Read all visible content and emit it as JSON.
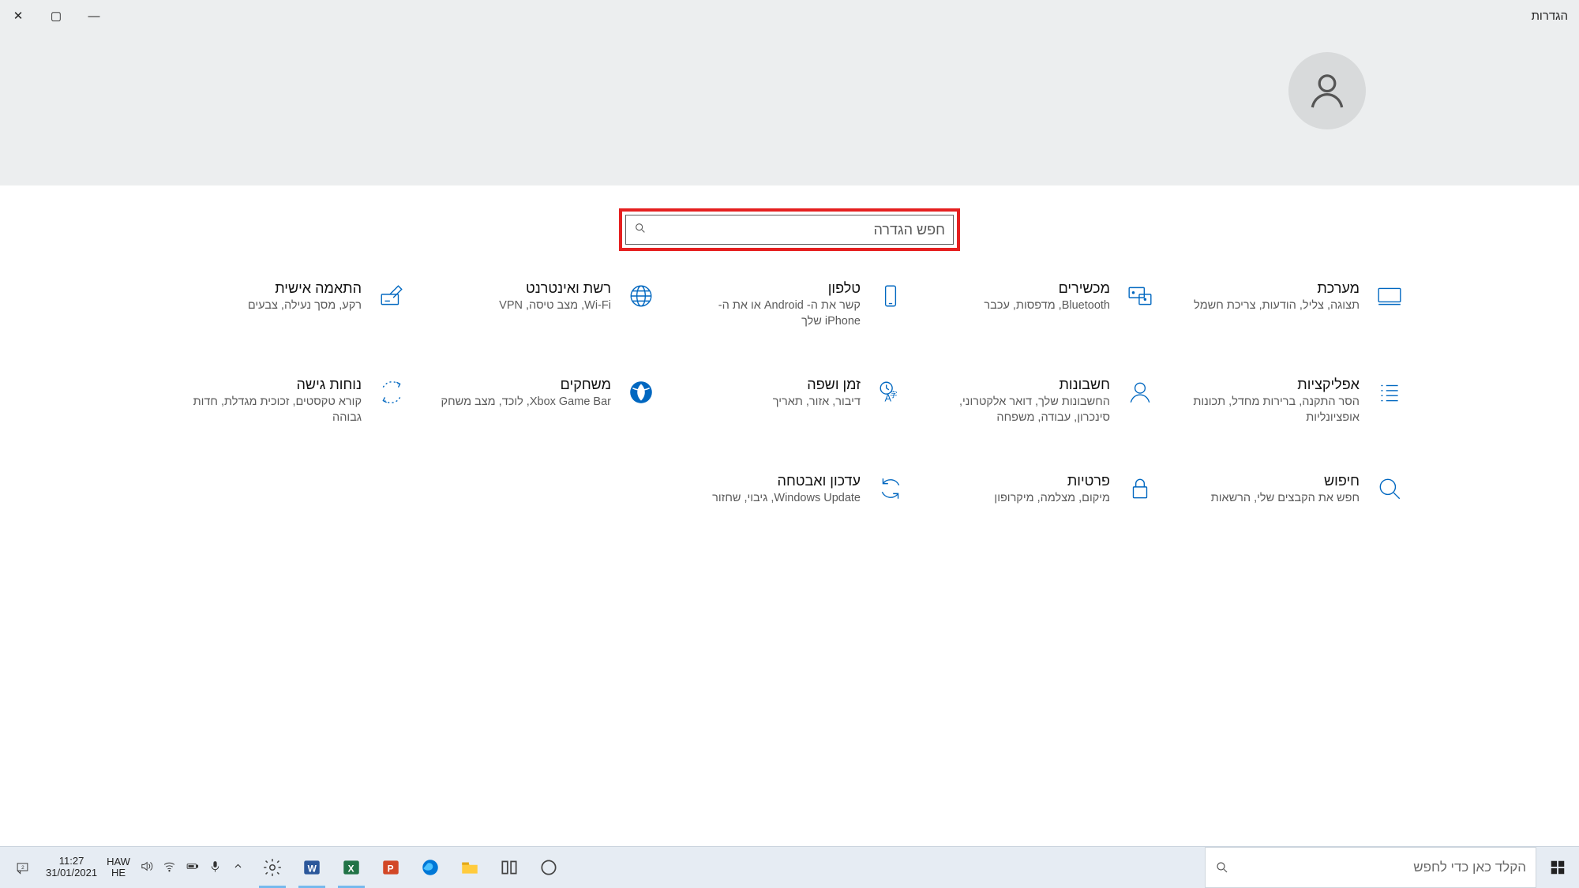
{
  "window": {
    "title": "הגדרות"
  },
  "search": {
    "placeholder": "חפש הגדרה"
  },
  "categories": [
    {
      "id": "system",
      "title": "מערכת",
      "desc": "תצוגה, צליל, הודעות, צריכת חשמל"
    },
    {
      "id": "devices",
      "title": "מכשירים",
      "desc": "Bluetooth, מדפסות, עכבר"
    },
    {
      "id": "phone",
      "title": "טלפון",
      "desc": "קשר את ה- Android או את ה- iPhone שלך"
    },
    {
      "id": "network",
      "title": "רשת ואינטרנט",
      "desc": "Wi-Fi, מצב טיסה, VPN"
    },
    {
      "id": "personalization",
      "title": "התאמה אישית",
      "desc": "רקע, מסך נעילה, צבעים"
    },
    {
      "id": "apps",
      "title": "אפליקציות",
      "desc": "הסר התקנה, ברירות מחדל, תכונות אופציונליות"
    },
    {
      "id": "accounts",
      "title": "חשבונות",
      "desc": "החשבונות שלך, דואר אלקטרוני, סינכרון, עבודה, משפחה"
    },
    {
      "id": "time",
      "title": "זמן ושפה",
      "desc": "דיבור, אזור, תאריך"
    },
    {
      "id": "gaming",
      "title": "משחקים",
      "desc": "Xbox Game Bar, לוכד, מצב משחק"
    },
    {
      "id": "ease",
      "title": "נוחות גישה",
      "desc": "קורא טקסטים, זכוכית מגדלת, חדות גבוהה"
    },
    {
      "id": "search-cat",
      "title": "חיפוש",
      "desc": "חפש את הקבצים שלי, הרשאות"
    },
    {
      "id": "privacy",
      "title": "פרטיות",
      "desc": "מיקום, מצלמה, מיקרופון"
    },
    {
      "id": "update",
      "title": "עדכון ואבטחה",
      "desc": "Windows Update, גיבוי, שחזור"
    }
  ],
  "taskbar": {
    "search_placeholder": "הקלד כאן כדי לחפש",
    "time": "11:27",
    "date": "31/01/2021",
    "lang1": "HAW",
    "lang2": "HE",
    "notif_count": "2"
  },
  "colors": {
    "accent": "#0067c0"
  }
}
